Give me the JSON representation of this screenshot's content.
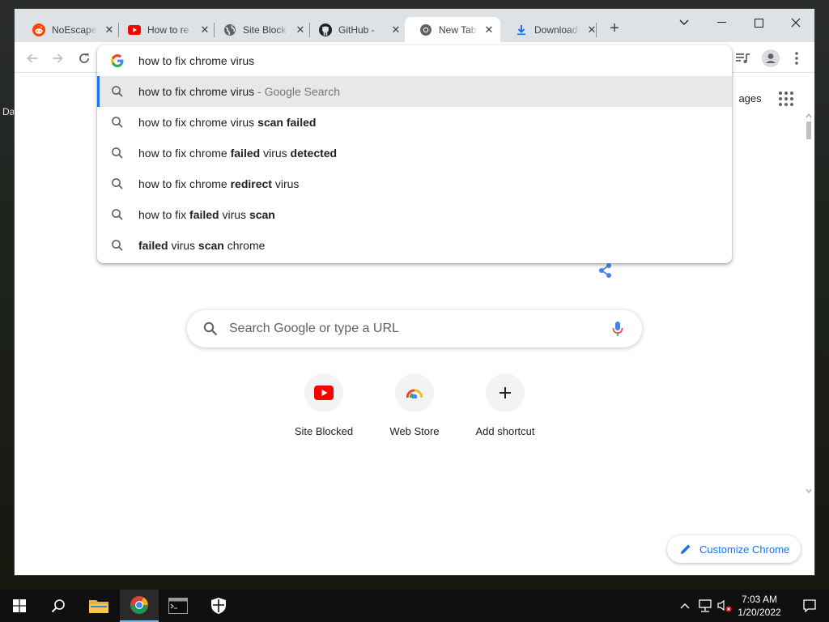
{
  "desktop": {
    "left_label": "Da"
  },
  "tabs": [
    {
      "title": "NoEscape",
      "icon": "reddit-icon",
      "active": false
    },
    {
      "title": "How to re",
      "icon": "youtube-icon",
      "active": false
    },
    {
      "title": "Site Block",
      "icon": "globe-icon",
      "active": false
    },
    {
      "title": "GitHub - ",
      "icon": "github-icon",
      "active": false
    },
    {
      "title": "New Tab",
      "icon": "chrome-icon",
      "active": true
    },
    {
      "title": "Download",
      "icon": "download-icon",
      "active": false
    }
  ],
  "omnibox": {
    "input_value": "how to fix chrome virus",
    "suggestions": [
      {
        "parts": [
          {
            "t": "how to fix chrome virus",
            "b": false
          }
        ],
        "suffix": " - Google Search",
        "selected": true
      },
      {
        "parts": [
          {
            "t": "how to fix chrome virus ",
            "b": false
          },
          {
            "t": "scan failed",
            "b": true
          }
        ],
        "suffix": "",
        "selected": false
      },
      {
        "parts": [
          {
            "t": "how to fix chrome ",
            "b": false
          },
          {
            "t": "failed",
            "b": true
          },
          {
            "t": " virus ",
            "b": false
          },
          {
            "t": "detected",
            "b": true
          }
        ],
        "suffix": "",
        "selected": false
      },
      {
        "parts": [
          {
            "t": "how to fix chrome ",
            "b": false
          },
          {
            "t": "redirect",
            "b": true
          },
          {
            "t": " virus",
            "b": false
          }
        ],
        "suffix": "",
        "selected": false
      },
      {
        "parts": [
          {
            "t": "how to fix ",
            "b": false
          },
          {
            "t": "failed",
            "b": true
          },
          {
            "t": " virus ",
            "b": false
          },
          {
            "t": "scan",
            "b": true
          }
        ],
        "suffix": "",
        "selected": false
      },
      {
        "parts": [
          {
            "t": "failed",
            "b": true
          },
          {
            "t": " virus ",
            "b": false
          },
          {
            "t": "scan",
            "b": true
          },
          {
            "t": " chrome",
            "b": false
          }
        ],
        "suffix": "",
        "selected": false
      }
    ]
  },
  "ntp": {
    "images_link": "Images",
    "search_placeholder": "Search Google or type a URL",
    "shortcuts": [
      {
        "label": "Site Blocked",
        "icon": "youtube-icon"
      },
      {
        "label": "Web Store",
        "icon": "chrome-webstore-icon"
      },
      {
        "label": "Add shortcut",
        "icon": "plus-icon"
      }
    ],
    "customize_label": "Customize Chrome"
  },
  "taskbar": {
    "time": "7:03 AM",
    "date": "1/20/2022"
  },
  "colors": {
    "accent": "#1a73e8",
    "tabstrip": "#dee1e6",
    "youtube_red": "#ff0000",
    "reddit_orange": "#ff4500"
  }
}
